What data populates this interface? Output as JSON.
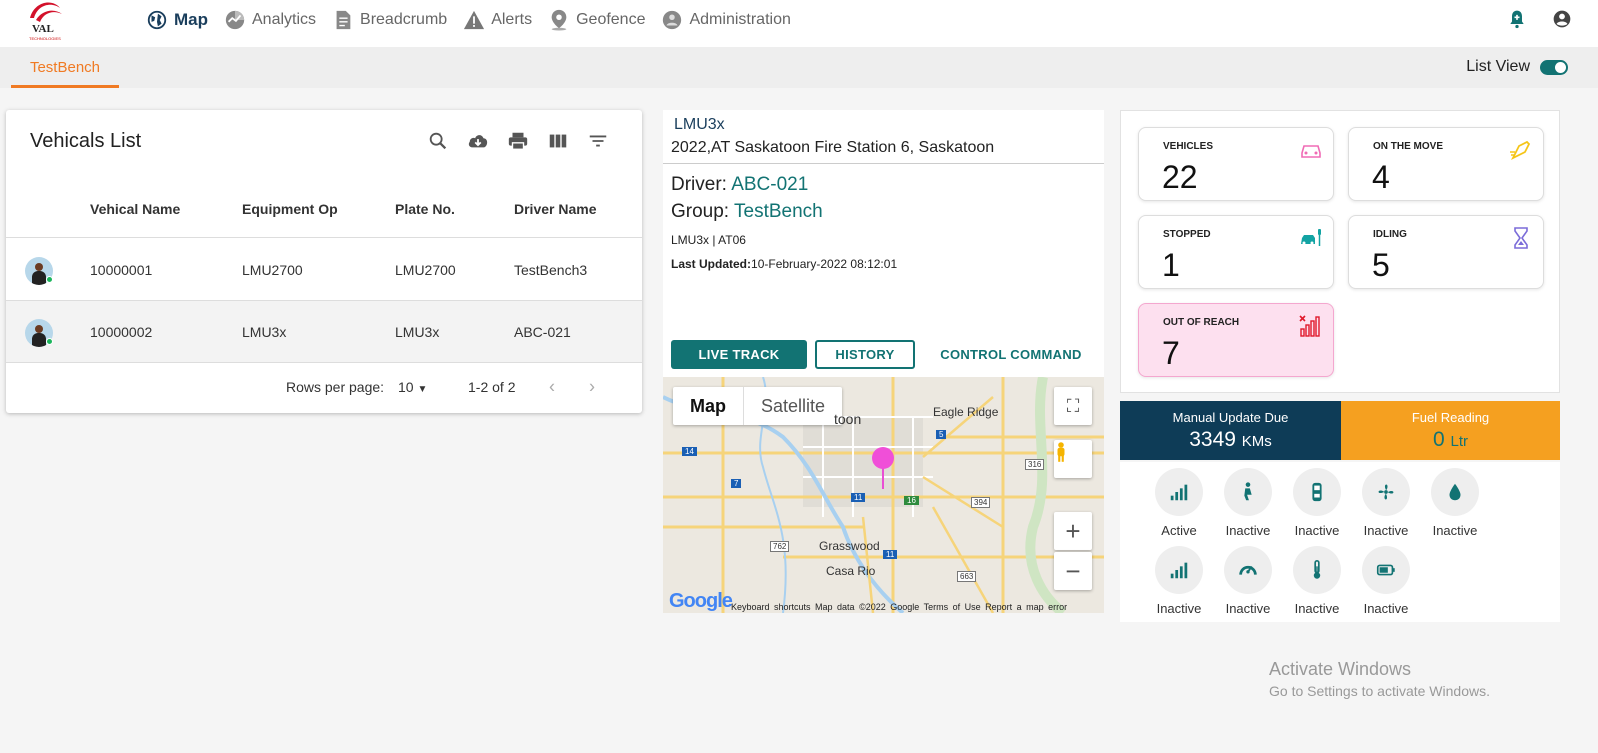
{
  "brand": {
    "logo_text": "VAL",
    "logo_subtext": "TECHNOLOGIES"
  },
  "nav": [
    {
      "label": "Map",
      "icon": "globe-icon",
      "active": true
    },
    {
      "label": "Analytics",
      "icon": "analytics-icon"
    },
    {
      "label": "Breadcrumb",
      "icon": "document-icon"
    },
    {
      "label": "Alerts",
      "icon": "warning-icon"
    },
    {
      "label": "Geofence",
      "icon": "location-pin-icon"
    },
    {
      "label": "Administration",
      "icon": "admin-icon"
    }
  ],
  "tabs": {
    "active": "TestBench"
  },
  "list_view": {
    "label": "List View",
    "enabled": true
  },
  "vehicle_list": {
    "title": "Vehicals List",
    "columns": [
      "Vehical Name",
      "Equipment Op",
      "Plate No.",
      "Driver Name"
    ],
    "rows": [
      {
        "name": "10000001",
        "equipment": "LMU2700",
        "plate": "LMU2700",
        "driver": "TestBench3"
      },
      {
        "name": "10000002",
        "equipment": "LMU3x",
        "plate": "LMU3x",
        "driver": "ABC-021"
      }
    ],
    "pager": {
      "rows_label": "Rows per page:",
      "rows_value": "10",
      "range": "1-2 of 2"
    }
  },
  "detail": {
    "device": "LMU3x",
    "address": "2022,AT Saskatoon Fire Station 6, Saskatoon",
    "driver_label": "Driver:",
    "driver_value": "ABC-021",
    "group_label": "Group:",
    "group_value": "TestBench",
    "device_info": "LMU3x | AT06",
    "updated_label": "Last Updated:",
    "updated_value": "10-February-2022 08:12:01",
    "buttons": {
      "live": "LIVE TRACK",
      "history": "HISTORY",
      "control": "CONTROL COMMAND"
    }
  },
  "map": {
    "tab_map": "Map",
    "tab_sat": "Satellite",
    "labels": {
      "city": "toon",
      "eagle": "Eagle Ridge",
      "grass": "Grasswood",
      "casa": "Casa Rio"
    },
    "shields": {
      "s5": "5",
      "s14": "14",
      "s7": "7",
      "s11a": "11",
      "s11b": "11",
      "s316": "316",
      "s394": "394",
      "s762": "762",
      "s663": "663",
      "s16": "16"
    },
    "google": "Google",
    "footer": "Keyboard shortcuts   Map data ©2022 Google   Terms of Use   Report a map error"
  },
  "stats": [
    {
      "label": "VEHICLES",
      "value": "22",
      "icon": "car-icon",
      "color": "#f06bb5"
    },
    {
      "label": "ON THE MOVE",
      "value": "4",
      "icon": "moving-car-icon",
      "color": "#f5c518"
    },
    {
      "label": "STOPPED",
      "value": "1",
      "icon": "parked-car-icon",
      "color": "#13a3a3"
    },
    {
      "label": "IDLING",
      "value": "5",
      "icon": "hourglass-icon",
      "color": "#7b6cd9"
    },
    {
      "label": "OUT OF REACH",
      "value": "7",
      "icon": "no-signal-icon",
      "color": "#e0192c"
    }
  ],
  "manual": {
    "label": "Manual Update Due",
    "value": "3349",
    "unit": "KMs"
  },
  "fuel": {
    "label": "Fuel Reading",
    "value": "0",
    "unit": "Ltr"
  },
  "sensors": [
    {
      "label": "Active",
      "icon": "signal-icon"
    },
    {
      "label": "Inactive",
      "icon": "seat-icon"
    },
    {
      "label": "Inactive",
      "icon": "door-icon"
    },
    {
      "label": "Inactive",
      "icon": "fan-icon"
    },
    {
      "label": "Inactive",
      "icon": "fuel-drop-icon"
    },
    {
      "label": "Inactive",
      "icon": "signal-icon"
    },
    {
      "label": "Inactive",
      "icon": "speedometer-icon"
    },
    {
      "label": "Inactive",
      "icon": "thermometer-icon"
    },
    {
      "label": "Inactive",
      "icon": "battery-icon"
    }
  ],
  "watermark": {
    "title": "Activate Windows",
    "sub": "Go to Settings to activate Windows."
  }
}
